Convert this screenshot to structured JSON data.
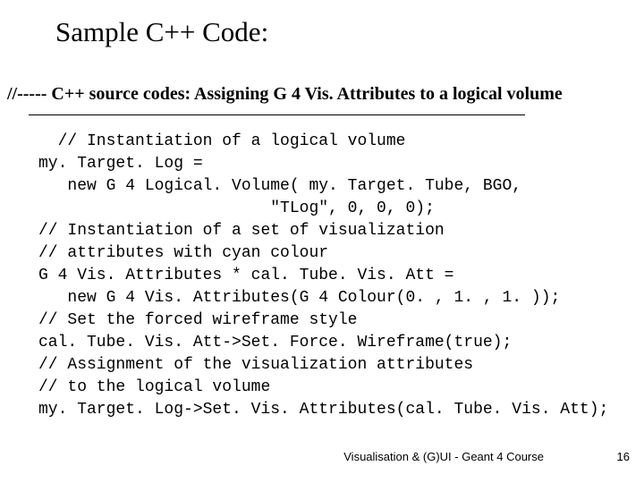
{
  "title": "Sample C++ Code:",
  "comment_header": "//----- C++ source codes: Assigning G 4 Vis. Attributes to a logical volume",
  "code_lines": [
    "  // Instantiation of a logical volume",
    "my. Target. Log =",
    "   new G 4 Logical. Volume( my. Target. Tube, BGO,",
    "                        \"TLog\", 0, 0, 0);",
    "// Instantiation of a set of visualization",
    "// attributes with cyan colour",
    "G 4 Vis. Attributes * cal. Tube. Vis. Att =",
    "   new G 4 Vis. Attributes(G 4 Colour(0. , 1. , 1. ));",
    "// Set the forced wireframe style",
    "cal. Tube. Vis. Att->Set. Force. Wireframe(true);",
    "// Assignment of the visualization attributes",
    "// to the logical volume",
    "my. Target. Log->Set. Vis. Attributes(cal. Tube. Vis. Att);"
  ],
  "footer": "Visualisation & (G)UI - Geant 4 Course",
  "page_number": "16"
}
